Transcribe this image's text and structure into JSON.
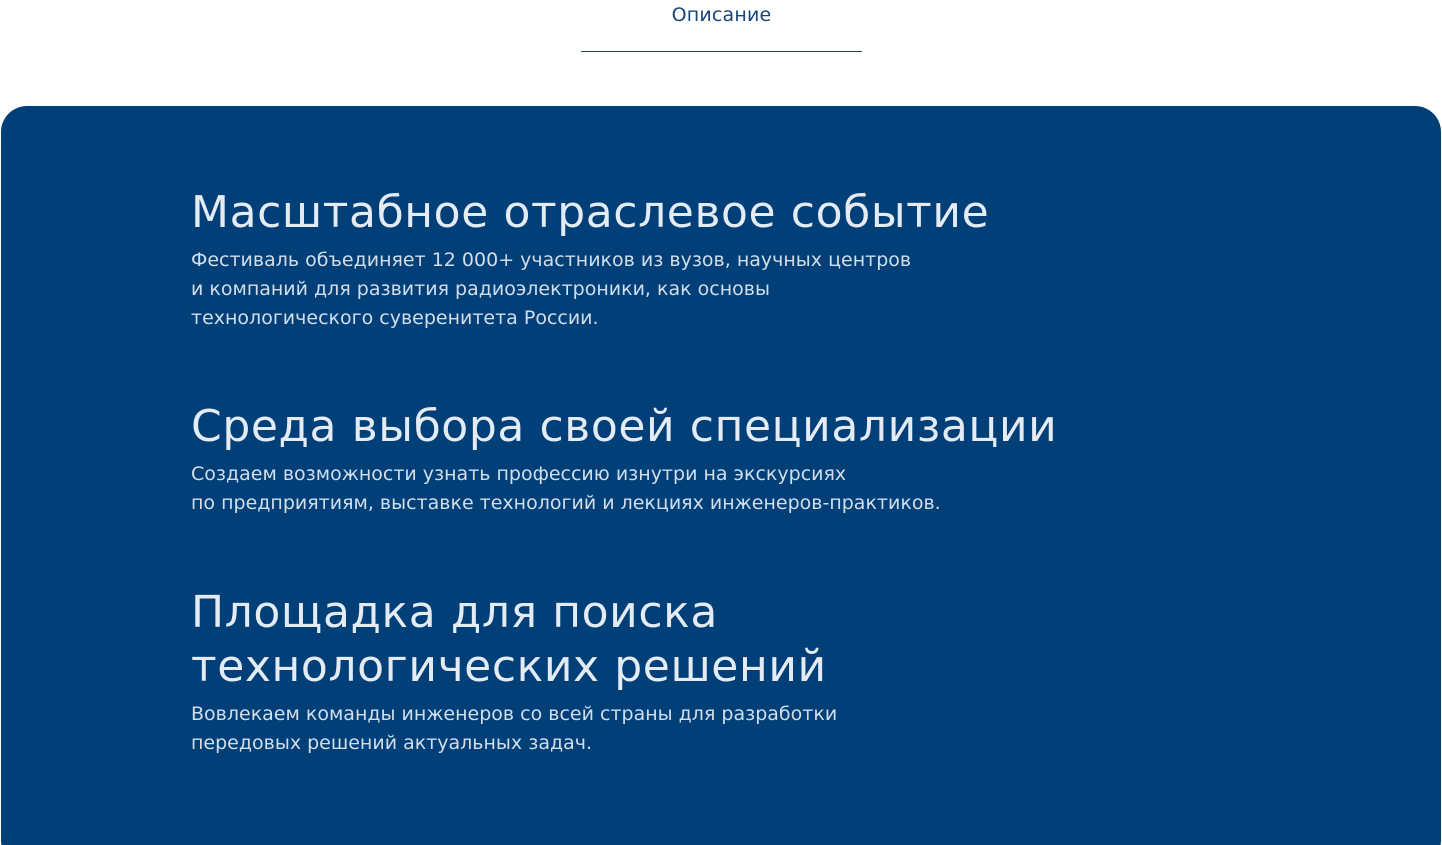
{
  "tabs": {
    "active_label": "Описание"
  },
  "colors": {
    "panel_background": "#003f77",
    "accent": "#1a4478",
    "heading_text": "#e4ebf3",
    "body_text": "#d3deea"
  },
  "features": [
    {
      "title": "Масштабное отраслевое событие",
      "text": "Фестиваль объединяет 12 000+ участников из вузов, научных центров\nи компаний для развития радиоэлектроники, как основы\nтехнологического суверенитета России."
    },
    {
      "title": "Среда выбора своей специализации",
      "text": "Создаем возможности узнать профессию изнутри на экскурсиях\nпо предприятиям, выставке технологий и лекциях инженеров-практиков."
    },
    {
      "title": "Площадка для поиска\nтехнологических решений",
      "text": "Вовлекаем команды инженеров со всей страны для разработки\nпередовых решений актуальных задач."
    }
  ]
}
